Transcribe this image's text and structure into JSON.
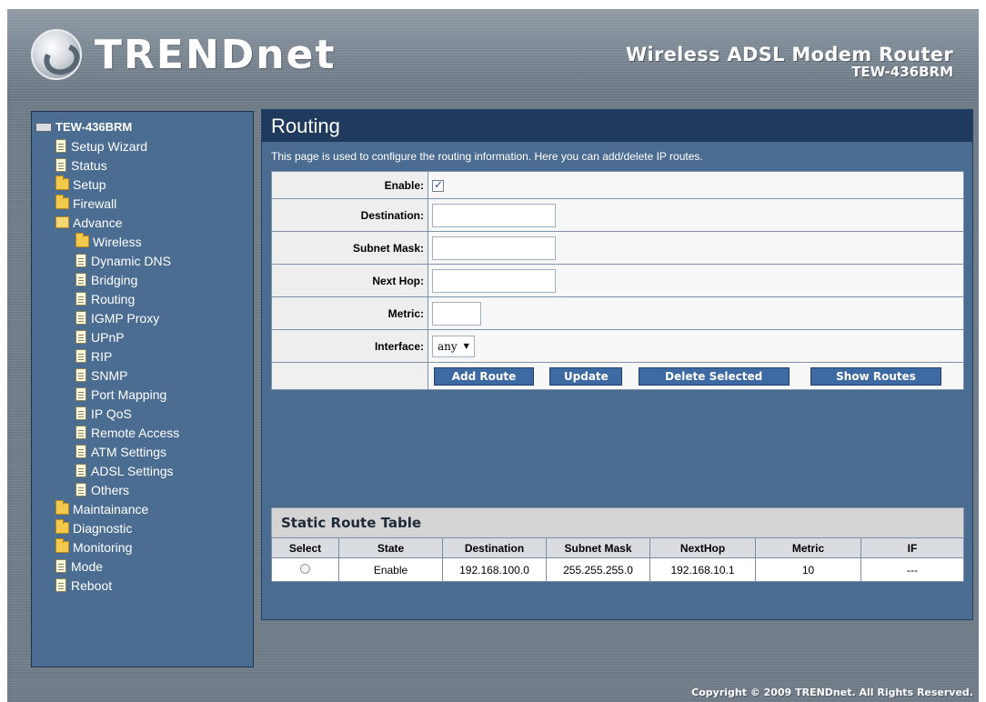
{
  "brand": {
    "logo_text": "TRENDnet",
    "product_title": "Wireless ADSL Modem Router",
    "model": "TEW-436BRM"
  },
  "sidebar": {
    "root": "TEW-436BRM",
    "items": [
      {
        "label": "Setup Wizard",
        "icon": "page-icon",
        "level": 1
      },
      {
        "label": "Status",
        "icon": "page-icon",
        "level": 1
      },
      {
        "label": "Setup",
        "icon": "folder-icon",
        "level": 1
      },
      {
        "label": "Firewall",
        "icon": "folder-icon",
        "level": 1
      },
      {
        "label": "Advance",
        "icon": "folder-open-icon",
        "level": 1
      },
      {
        "label": "Wireless",
        "icon": "folder-icon",
        "level": 2
      },
      {
        "label": "Dynamic DNS",
        "icon": "page-icon",
        "level": 2
      },
      {
        "label": "Bridging",
        "icon": "page-icon",
        "level": 2
      },
      {
        "label": "Routing",
        "icon": "page-icon",
        "level": 2
      },
      {
        "label": "IGMP Proxy",
        "icon": "page-icon",
        "level": 2
      },
      {
        "label": "UPnP",
        "icon": "page-icon",
        "level": 2
      },
      {
        "label": "RIP",
        "icon": "page-icon",
        "level": 2
      },
      {
        "label": "SNMP",
        "icon": "page-icon",
        "level": 2
      },
      {
        "label": "Port Mapping",
        "icon": "page-icon",
        "level": 2
      },
      {
        "label": "IP QoS",
        "icon": "page-icon",
        "level": 2
      },
      {
        "label": "Remote Access",
        "icon": "page-icon",
        "level": 2
      },
      {
        "label": "ATM Settings",
        "icon": "page-icon",
        "level": 2
      },
      {
        "label": "ADSL Settings",
        "icon": "page-icon",
        "level": 2
      },
      {
        "label": "Others",
        "icon": "page-icon",
        "level": 2
      },
      {
        "label": "Maintainance",
        "icon": "folder-icon",
        "level": 1
      },
      {
        "label": "Diagnostic",
        "icon": "folder-icon",
        "level": 1
      },
      {
        "label": "Monitoring",
        "icon": "folder-icon",
        "level": 1
      },
      {
        "label": "Mode",
        "icon": "page-icon",
        "level": 1
      },
      {
        "label": "Reboot",
        "icon": "page-icon",
        "level": 1
      }
    ]
  },
  "main": {
    "title": "Routing",
    "description": "This page is used to configure the routing information. Here you can add/delete IP routes.",
    "form": {
      "enable_label": "Enable:",
      "enable_checked": true,
      "destination_label": "Destination:",
      "destination_value": "",
      "subnet_label": "Subnet Mask:",
      "subnet_value": "",
      "nexthop_label": "Next Hop:",
      "nexthop_value": "",
      "metric_label": "Metric:",
      "metric_value": "",
      "interface_label": "Interface:",
      "interface_value": "any"
    },
    "buttons": {
      "add": "Add Route",
      "update": "Update",
      "delete": "Delete Selected",
      "show": "Show Routes"
    },
    "static_table": {
      "title": "Static Route Table",
      "headers": [
        "Select",
        "State",
        "Destination",
        "Subnet Mask",
        "NextHop",
        "Metric",
        "IF"
      ],
      "rows": [
        {
          "state": "Enable",
          "destination": "192.168.100.0",
          "subnet": "255.255.255.0",
          "nexthop": "192.168.10.1",
          "metric": "10",
          "if": "---"
        }
      ]
    }
  },
  "footer": {
    "copyright": "Copyright © 2009 TRENDnet. All Rights Reserved."
  },
  "colors": {
    "panel": "#4a6c91",
    "title_bar": "#1f3a5c",
    "button": "#3d6aa2"
  }
}
